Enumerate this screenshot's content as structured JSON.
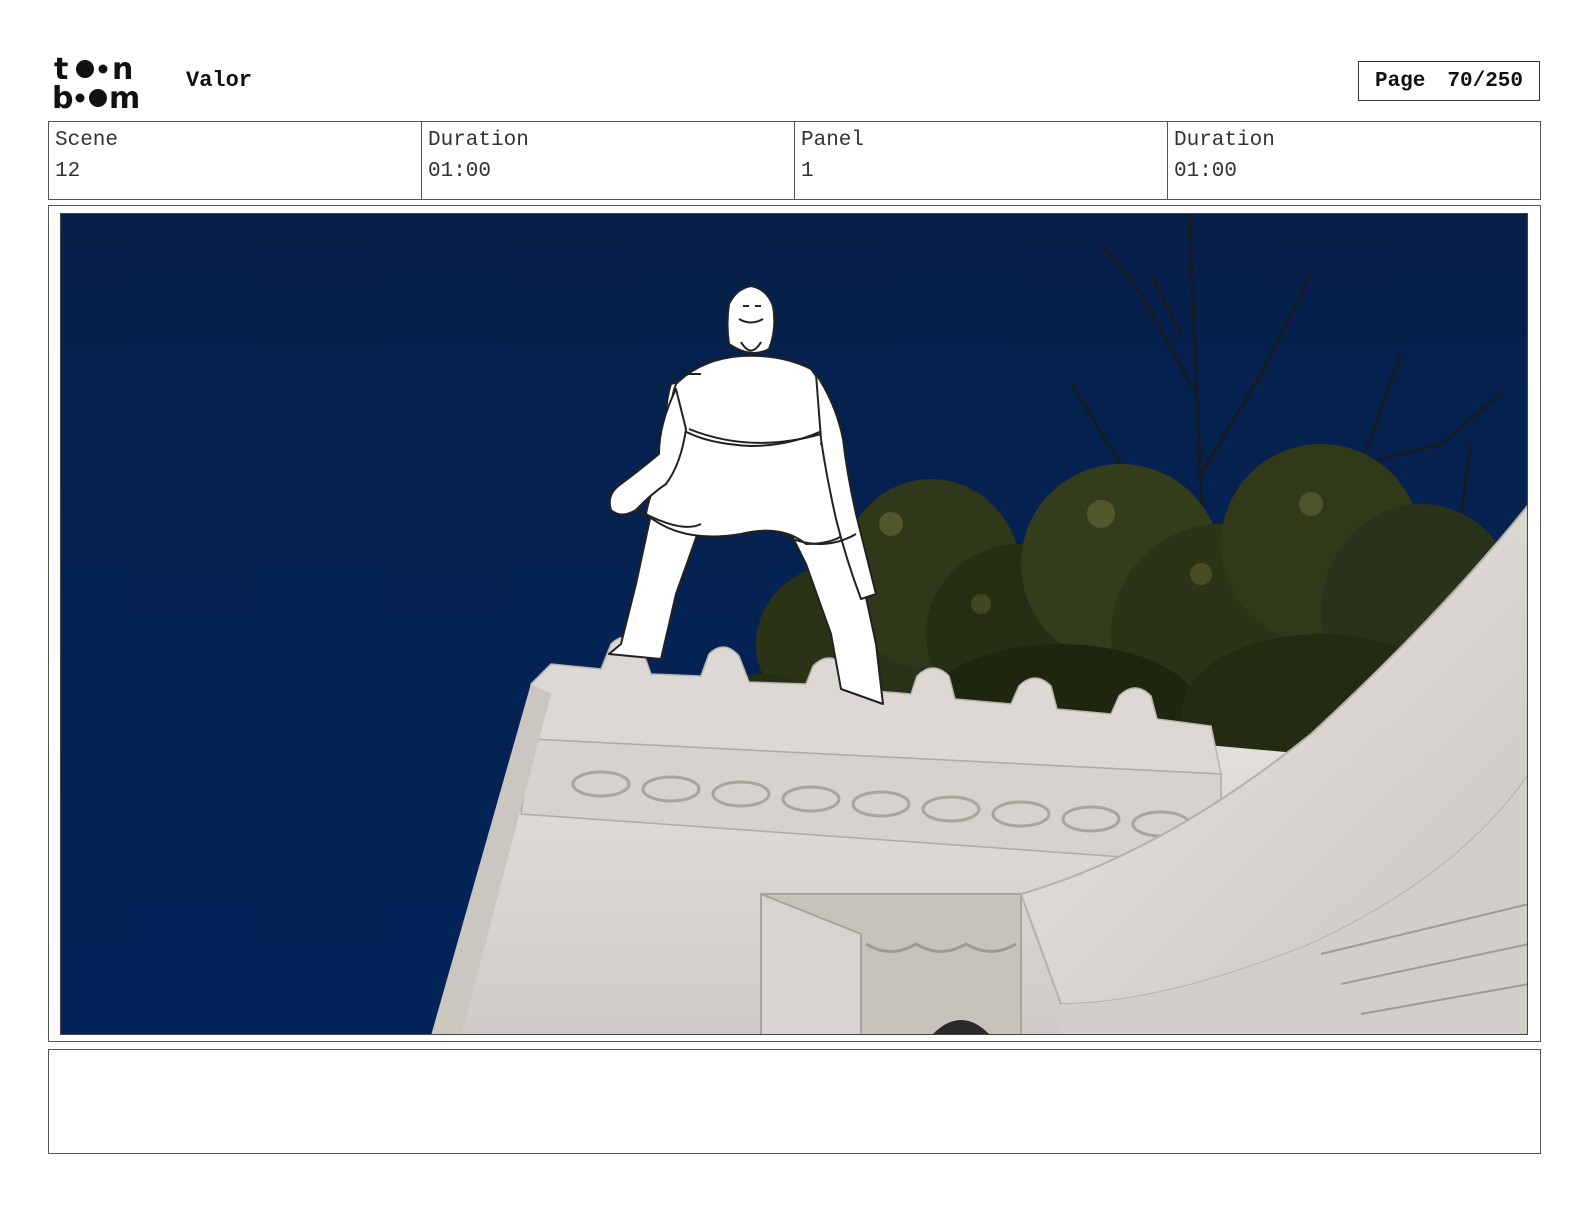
{
  "header": {
    "logo_text": "toon boom",
    "project_title": "Valor",
    "page_label": "Page",
    "page_value": "70/250"
  },
  "info": {
    "scene_label": "Scene",
    "scene_value": "12",
    "scene_duration_label": "Duration",
    "scene_duration_value": "01:00",
    "panel_label": "Panel",
    "panel_value": "1",
    "panel_duration_label": "Duration",
    "panel_duration_value": "01:00"
  },
  "panel": {
    "image_icon": "storyboard-panel-image",
    "sky_color": "#06224e",
    "building_color": "#dedad6"
  },
  "notes": {
    "text": ""
  }
}
